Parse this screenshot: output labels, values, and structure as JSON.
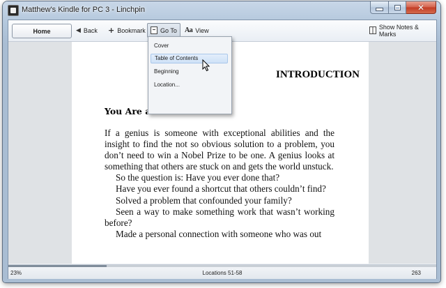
{
  "window": {
    "title": "Matthew's Kindle for PC 3 - Linchpin"
  },
  "toolbar": {
    "home_label": "Home",
    "back_label": "Back",
    "bookmark_label": "Bookmark",
    "goto_label": "Go To",
    "view_label": "View",
    "view_icon_text": "Aa",
    "notes_label": "Show Notes & Marks"
  },
  "goto_menu": {
    "items": [
      "Cover",
      "Table of Contents",
      "Beginning",
      "Location..."
    ],
    "highlighted": "Table of Contents"
  },
  "page": {
    "chapter_heading": "INTRODUCTION",
    "section_heading": "You Are a Genius",
    "paragraphs": [
      "If a genius is someone with exceptional abilities and the insight to find the not so obvious solution to a problem, you don’t need to win a Nobel Prize to be one. A genius looks at something that others are stuck on and gets the world unstuck.",
      "So the question is: Have you ever done that?",
      "Have you ever found a shortcut that others couldn’t find?",
      "Solved a problem that confounded your family?",
      "Seen a way to make something work that wasn’t working before?",
      "Made a personal connection with someone who was out"
    ]
  },
  "status": {
    "percent": "23%",
    "progress_fraction": 0.23,
    "locations": "Locations 51-58",
    "page_number": "263"
  }
}
